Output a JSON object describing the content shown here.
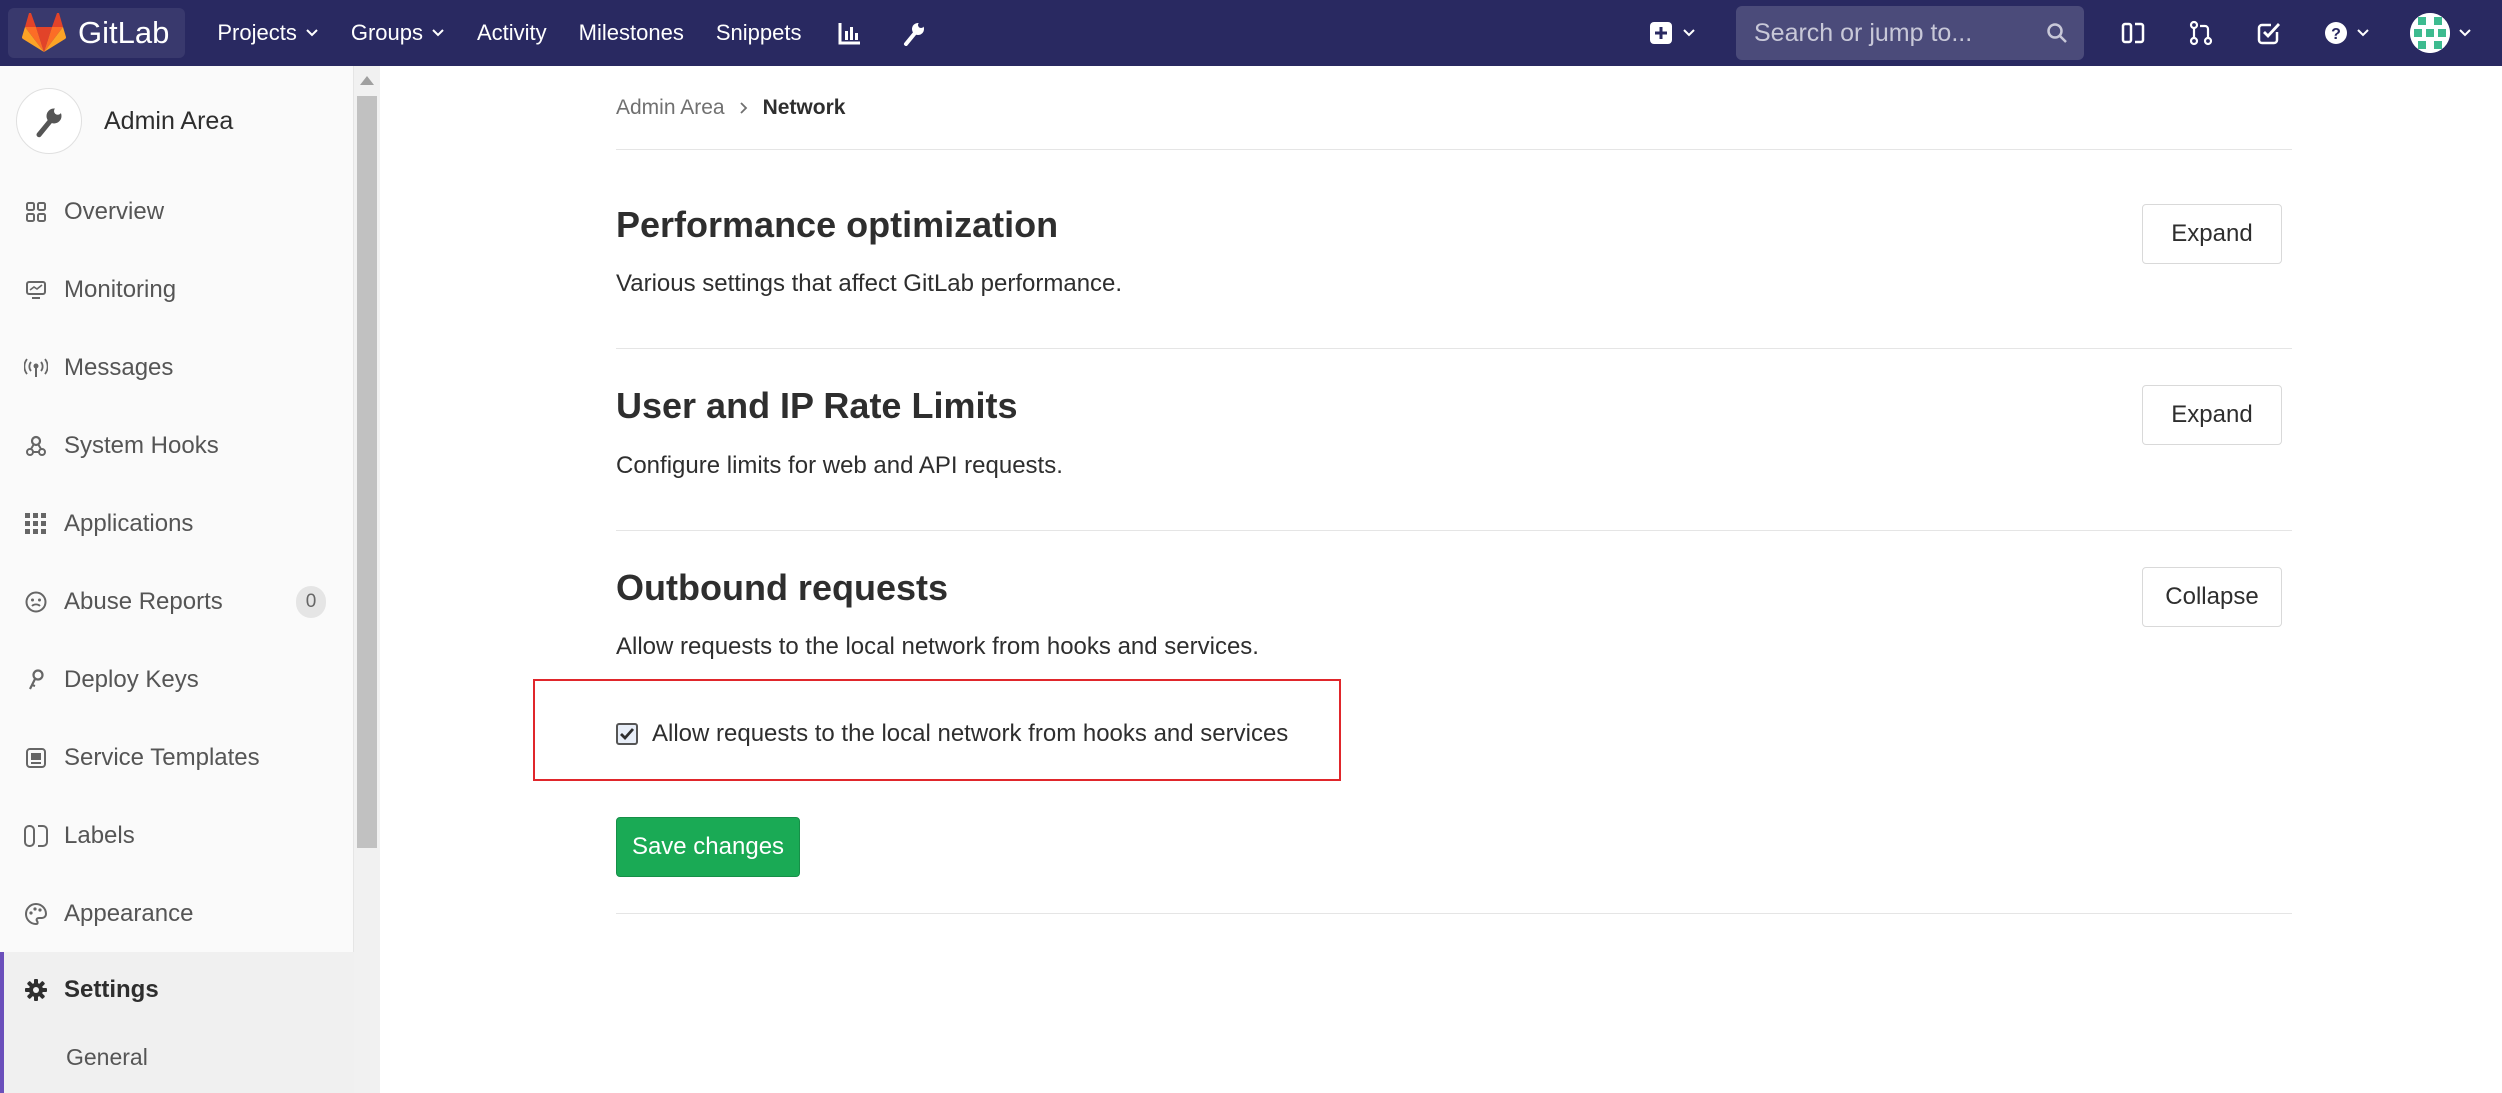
{
  "navbar": {
    "brand": "GitLab",
    "menu": {
      "projects": "Projects",
      "groups": "Groups",
      "activity": "Activity",
      "milestones": "Milestones",
      "snippets": "Snippets"
    },
    "search_placeholder": "Search or jump to...",
    "icons": [
      "chart-icon",
      "wrench-icon",
      "plus-square-icon",
      "issues-icon",
      "merge-request-icon",
      "todo-icon",
      "help-icon",
      "user-avatar"
    ]
  },
  "sidebar": {
    "title": "Admin Area",
    "items": [
      {
        "label": "Overview",
        "icon": "grid-icon"
      },
      {
        "label": "Monitoring",
        "icon": "monitor-icon"
      },
      {
        "label": "Messages",
        "icon": "broadcast-icon"
      },
      {
        "label": "System Hooks",
        "icon": "hook-icon"
      },
      {
        "label": "Applications",
        "icon": "apps-grid-icon"
      },
      {
        "label": "Abuse Reports",
        "icon": "face-icon",
        "badge": "0"
      },
      {
        "label": "Deploy Keys",
        "icon": "key-icon"
      },
      {
        "label": "Service Templates",
        "icon": "template-icon"
      },
      {
        "label": "Labels",
        "icon": "labels-icon"
      },
      {
        "label": "Appearance",
        "icon": "palette-icon"
      },
      {
        "label": "Settings",
        "icon": "gear-icon",
        "active": true
      }
    ],
    "sub_items": [
      "General"
    ]
  },
  "breadcrumb": {
    "parent": "Admin Area",
    "current": "Network"
  },
  "sections": [
    {
      "title": "Performance optimization",
      "description": "Various settings that affect GitLab performance.",
      "button": "Expand"
    },
    {
      "title": "User and IP Rate Limits",
      "description": "Configure limits for web and API requests.",
      "button": "Expand"
    },
    {
      "title": "Outbound requests",
      "description": "Allow requests to the local network from hooks and services.",
      "button": "Collapse"
    }
  ],
  "outbound": {
    "checkbox_label": "Allow requests to the local network from hooks and services",
    "checked": true,
    "save_label": "Save changes"
  },
  "colors": {
    "navbar": "#292961",
    "save_button": "#1aaa55",
    "active_accent": "#6b4fbb",
    "highlight_box": "#e0262b"
  }
}
